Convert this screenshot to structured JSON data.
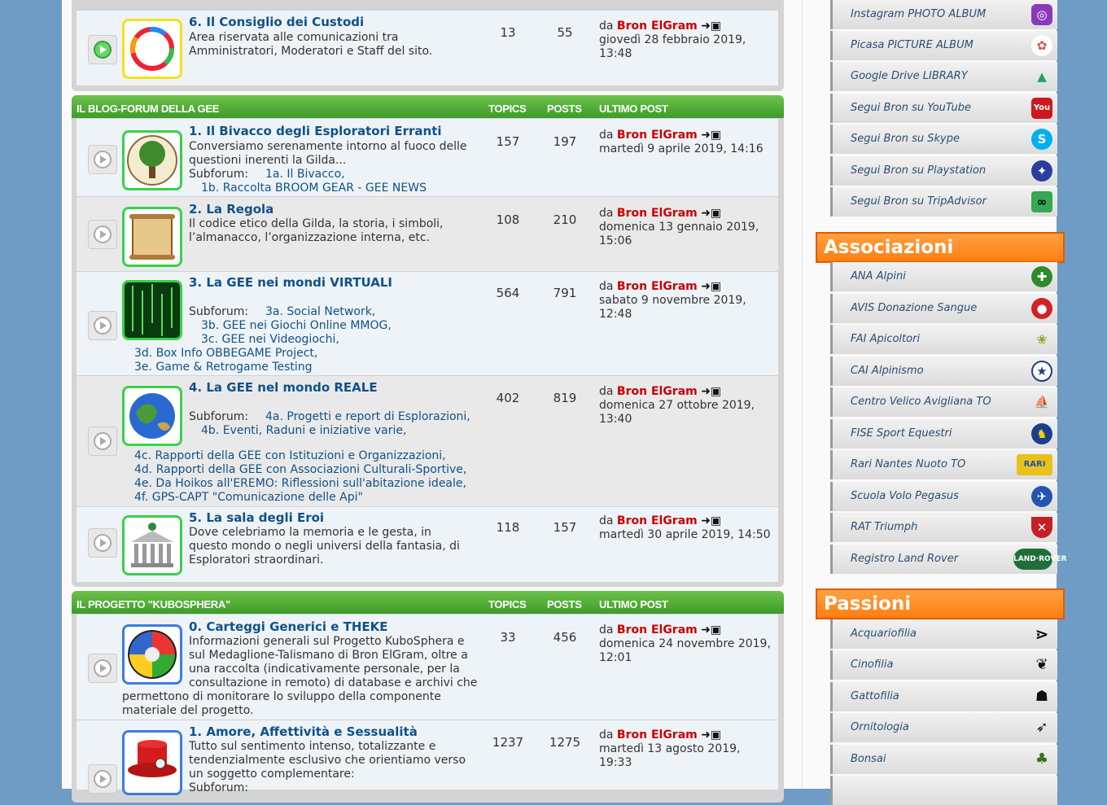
{
  "sections": [
    {
      "title": "IL BLOG-FORUM DELLA GEE",
      "col_topics": "TOPICS",
      "col_posts": "POSTS",
      "col_last": "ULTIMO POST"
    },
    {
      "title": "IL PROGETTO \"KUBOSPHERA\"",
      "col_topics": "TOPICS",
      "col_posts": "POSTS",
      "col_last": "ULTIMO POST"
    }
  ],
  "forums": [
    {
      "title": "6. Il Consiglio dei Custodi",
      "desc": "Area riservata alle comunicazioni tra Amministratori, Moderatori e Staff del sito.",
      "topics": "13",
      "posts": "55",
      "lp_prefix": "da",
      "lp_author": "Bron ElGram",
      "lp_date": "giovedì 28 febbraio 2019, 13:48"
    },
    {
      "title": "1. Il Bivacco degli Esploratori Erranti",
      "desc": "Conversiamo serenamente intorno al fuoco delle questioni inerenti la Gilda...",
      "sublabel": "Subforum:",
      "subs": [
        "1a. Il Bivacco,",
        "1b. Raccolta BROOM GEAR - GEE NEWS"
      ],
      "topics": "157",
      "posts": "197",
      "lp_prefix": "da",
      "lp_author": "Bron ElGram",
      "lp_date": "martedì 9 aprile 2019, 14:16"
    },
    {
      "title": "2. La Regola",
      "desc": "Il codice etico della Gilda, la storia, i simboli, l’almanacco, l’organizzazione interna, etc.",
      "topics": "108",
      "posts": "210",
      "lp_prefix": "da",
      "lp_author": "Bron ElGram",
      "lp_date": "domenica 13 gennaio 2019, 15:06"
    },
    {
      "title": "3. La GEE nei mondi VIRTUALI",
      "sublabel": "Subforum:",
      "subs": [
        "3a. Social Network,",
        "3b. GEE nei Giochi Online MMOG,",
        "3c. GEE nei Videogiochi,",
        "3d. Box Info OBBEGAME Project,",
        "3e. Game & Retrogame Testing"
      ],
      "topics": "564",
      "posts": "791",
      "lp_prefix": "da",
      "lp_author": "Bron ElGram",
      "lp_date": "sabato 9 novembre 2019, 12:48"
    },
    {
      "title": "4. La GEE nel mondo REALE",
      "sublabel": "Subforum:",
      "subs": [
        "4a. Progetti e report di Esplorazioni,",
        "4b. Eventi, Raduni e iniziative varie,",
        "4c. Rapporti della GEE con Istituzioni e Organizzazioni,",
        "4d. Rapporti della GEE con Associazioni Culturali-Sportive,",
        "4e. Da Hoikos all'EREMO: Riflessioni sull'abitazione ideale,",
        "4f. GPS-CAPT \"Comunicazione delle Api\""
      ],
      "topics": "402",
      "posts": "819",
      "lp_prefix": "da",
      "lp_author": "Bron ElGram",
      "lp_date": "domenica 27 ottobre 2019, 13:40"
    },
    {
      "title": "5. La sala degli Eroi",
      "desc": "Dove celebriamo la memoria e le gesta, in questo mondo o negli universi della fantasia, di Esploratori straordinari.",
      "topics": "118",
      "posts": "157",
      "lp_prefix": "da",
      "lp_author": "Bron ElGram",
      "lp_date": "martedì 30 aprile 2019, 14:50"
    },
    {
      "title": "0. Carteggi Generici e THEKE",
      "desc_a": "Informazioni generali sul Progetto KuboSphera e sul Medaglione-Talismano di Bron ElGram, oltre a una raccolta (indicativamente personale, per la consultazione in remoto) di database e archivi che",
      "desc_b": "permettono di monitorare lo sviluppo della componente materiale del progetto.",
      "topics": "33",
      "posts": "456",
      "lp_prefix": "da",
      "lp_author": "Bron ElGram",
      "lp_date": "domenica 24 novembre 2019, 12:01"
    },
    {
      "title": "1. Amore, Affettività e Sessualità",
      "desc": "Tutto sul sentimento intenso, totalizzante e tendenzialmente esclusivo che orientiamo verso un soggetto complementare:",
      "sublabel": "Subforum:",
      "topics": "1237",
      "posts": "1275",
      "lp_prefix": "da",
      "lp_author": "Bron ElGram",
      "lp_date": "martedì 13 agosto 2019, 19:33"
    }
  ],
  "sidebar": {
    "links": [
      {
        "label": "Instagram PHOTO ALBUM",
        "icon": "instagram-icon",
        "color": "#8a3ab9"
      },
      {
        "label": "Picasa PICTURE ALBUM",
        "icon": "picasa-icon",
        "color": "#e84c3d"
      },
      {
        "label": "Google Drive LIBRARY",
        "icon": "google-drive-icon",
        "color": "#1fa463"
      },
      {
        "label": "Segui Bron su YouTube",
        "icon": "youtube-icon",
        "color": "#cc181e"
      },
      {
        "label": "Segui Bron su Skype",
        "icon": "skype-icon",
        "color": "#00aff0"
      },
      {
        "label": "Segui Bron su Playstation",
        "icon": "playstation-icon",
        "color": "#2a3f9c"
      },
      {
        "label": "Segui Bron su TripAdvisor",
        "icon": "tripadvisor-icon",
        "color": "#34a853"
      }
    ],
    "associazioni_title": "Associazioni",
    "associazioni": [
      {
        "label": "ANA Alpini",
        "icon": "ana-icon",
        "color": "#2d8a2d"
      },
      {
        "label": "AVIS Donazione Sangue",
        "icon": "avis-icon",
        "color": "#d42121"
      },
      {
        "label": "FAI Apicoltori",
        "icon": "fai-icon",
        "color": "#c7c72a"
      },
      {
        "label": "CAI Alpinismo",
        "icon": "cai-icon",
        "color": "#1f3c8a"
      },
      {
        "label": "Centro Velico Avigliana TO",
        "icon": "sail-icon",
        "color": "#3a9ad9"
      },
      {
        "label": "FISE Sport Equestri",
        "icon": "fise-icon",
        "color": "#1a3d8f"
      },
      {
        "label": "Rari Nantes Nuoto TO",
        "icon": "rari-icon",
        "color": "#e8c21a"
      },
      {
        "label": "Scuola Volo Pegasus",
        "icon": "pegasus-icon",
        "color": "#2355b0"
      },
      {
        "label": "RAT Triumph",
        "icon": "triumph-icon",
        "color": "#c42026"
      },
      {
        "label": "Registro Land Rover",
        "icon": "landrover-icon",
        "color": "#1f6e3a"
      }
    ],
    "passioni_title": "Passioni",
    "passioni": [
      {
        "label": "Acquariofilia",
        "icon": "fish-icon",
        "color": "#111111"
      },
      {
        "label": "Cinofilia",
        "icon": "paw-icon",
        "color": "#111111"
      },
      {
        "label": "Gattofilia",
        "icon": "cat-icon",
        "color": "#111111"
      },
      {
        "label": "Ornitologia",
        "icon": "bird-icon",
        "color": "#111111"
      },
      {
        "label": "Bonsai",
        "icon": "bonsai-icon",
        "color": "#3c6e1f"
      }
    ]
  }
}
